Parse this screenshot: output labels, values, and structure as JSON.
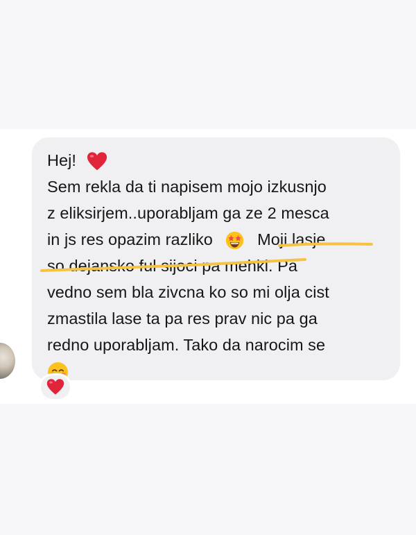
{
  "message": {
    "lines": [
      "Hej!",
      "Sem rekla da ti napisem mojo izkusnjo",
      "z eliksirjem..uporabljam ga ze 2 mesca",
      "in js res opazim razliko",
      "Moji lasje",
      "so dejansko ful sijoci pa mehki. Pa",
      "vedno sem bla zivcna ko so mi olja cist",
      "zmastila lase ta pa res prav nic pa ga",
      "redno uporabljam. Tako da narocim se"
    ],
    "emojis": {
      "line1": "red-heart",
      "line4": "star-struck-face",
      "line9": "smiling-face"
    }
  },
  "reaction": {
    "emoji": "red-heart"
  },
  "colors": {
    "bubble": "#f0f0f3",
    "text": "#161616",
    "highlight": "#f5c242",
    "heart": "#e0243a"
  }
}
